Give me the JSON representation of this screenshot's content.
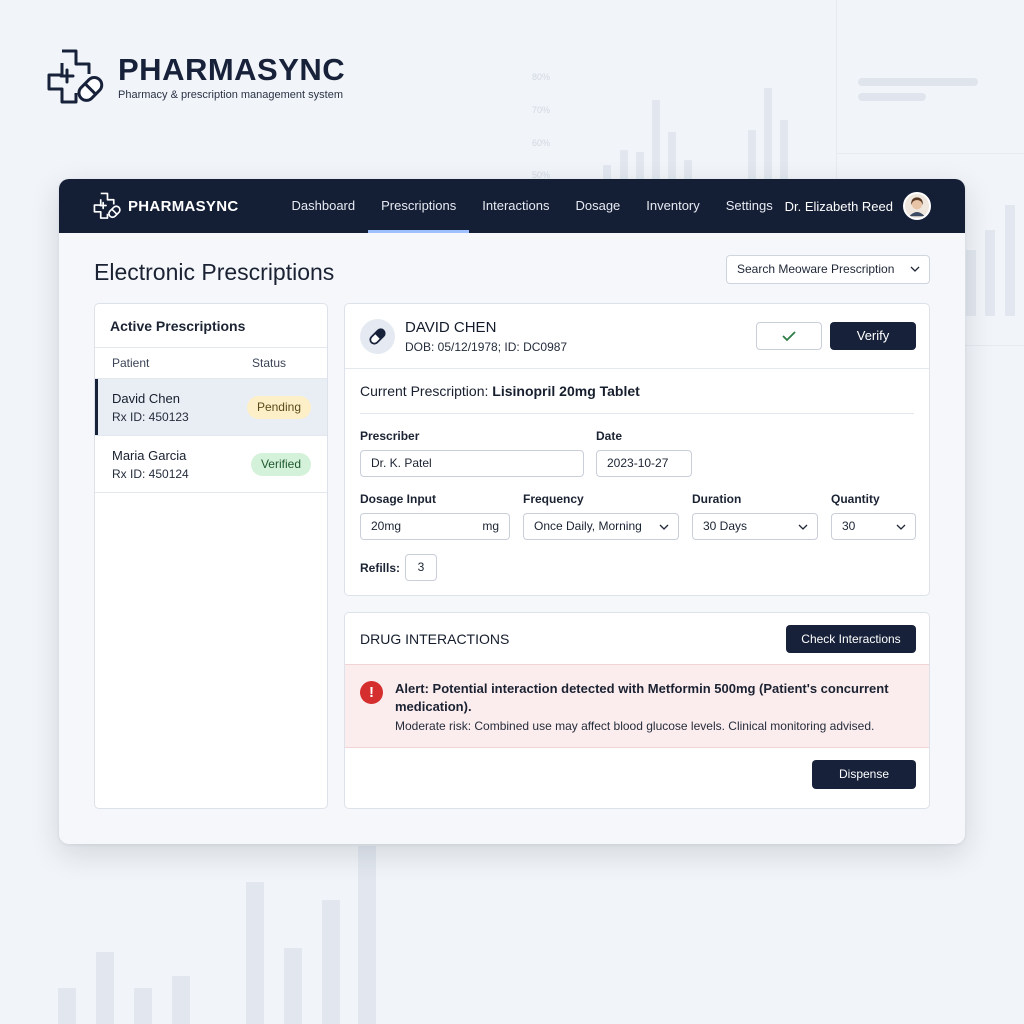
{
  "brand": {
    "title": "PHARMASYNC",
    "subtitle": "Pharmacy & prescription management system"
  },
  "background": {
    "ticks": [
      "80%",
      "70%",
      "60%",
      "50%"
    ]
  },
  "navbar": {
    "logo_text": "PHARMASYNC",
    "tabs": [
      {
        "label": "Dashboard",
        "active": false
      },
      {
        "label": "Prescriptions",
        "active": true
      },
      {
        "label": "Interactions",
        "active": false
      },
      {
        "label": "Dosage",
        "active": false
      },
      {
        "label": "Inventory",
        "active": false
      },
      {
        "label": "Settings",
        "active": false
      }
    ],
    "user_name": "Dr. Elizabeth Reed"
  },
  "page": {
    "title": "Electronic Prescriptions",
    "search_select": "Search Meoware Prescription"
  },
  "active_prescriptions": {
    "title": "Active Prescriptions",
    "col_patient": "Patient",
    "col_status": "Status",
    "rows": [
      {
        "name": "David Chen",
        "rx": "Rx ID: 450123",
        "status": "Pending",
        "selected": true
      },
      {
        "name": "Maria Garcia",
        "rx": "Rx ID: 450124",
        "status": "Verified",
        "selected": false
      }
    ]
  },
  "patient": {
    "name": "DAVID CHEN",
    "dob_line": "DOB: 05/12/1978; ID: DC0987",
    "verify_label": "Verify"
  },
  "prescription": {
    "current_prefix": "Current Prescription: ",
    "current_drug": "Lisinopril 20mg Tablet",
    "prescriber_label": "Prescriber",
    "prescriber_value": "Dr. K. Patel",
    "date_label": "Date",
    "date_value": "2023-10-27",
    "dosage_label": "Dosage Input",
    "dosage_value": "20mg",
    "dosage_unit": "mg",
    "frequency_label": "Frequency",
    "frequency_value": "Once Daily, Morning",
    "duration_label": "Duration",
    "duration_value": "30 Days",
    "quantity_label": "Quantity",
    "quantity_value": "30",
    "refills_label": "Refills:",
    "refills_value": "3"
  },
  "interactions": {
    "title": "DRUG INTERACTIONS",
    "check_label": "Check Interactions",
    "alert_title": "Alert: Potential interaction detected with Metformin 500mg (Patient's concurrent medication).",
    "alert_desc": "Moderate risk: Combined use may affect blood glucose levels. Clinical monitoring advised.",
    "alert_icon": "!",
    "dispense_label": "Dispense"
  },
  "colors": {
    "navy": "#141e35",
    "accent": "#9ec0ff",
    "pending": "#fdf0c9",
    "verified": "#d4f1d9",
    "alert": "#d52e2e"
  }
}
